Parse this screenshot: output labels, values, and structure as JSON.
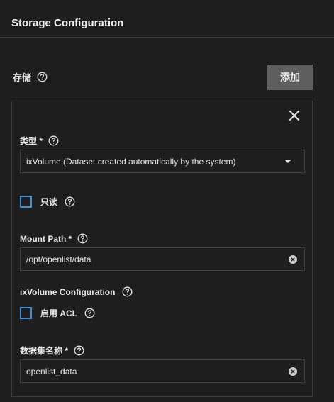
{
  "section": {
    "title": "Storage Configuration"
  },
  "storage": {
    "label": "存储",
    "add_label": "添加"
  },
  "card": {
    "type_field": {
      "label": "类型 *",
      "value": "ixVolume (Dataset created automatically by the system)"
    },
    "readonly": {
      "label": "只读",
      "checked": false
    },
    "mount_path": {
      "label": "Mount Path *",
      "value": "/opt/openlist/data"
    },
    "ixvolume_config": {
      "title": "ixVolume Configuration"
    },
    "enable_acl": {
      "label": "启用 ACL",
      "checked": false
    },
    "dataset_name": {
      "label": "数据集名称 *",
      "value": "openlist_data"
    }
  },
  "colors": {
    "background": "#1e1e1e",
    "accent": "#3f8fd6",
    "button_bg": "#5e5e5e",
    "border": "#3f3f3f"
  },
  "icons": [
    "help-icon",
    "close-icon",
    "chevron-down-icon",
    "clear-icon"
  ]
}
